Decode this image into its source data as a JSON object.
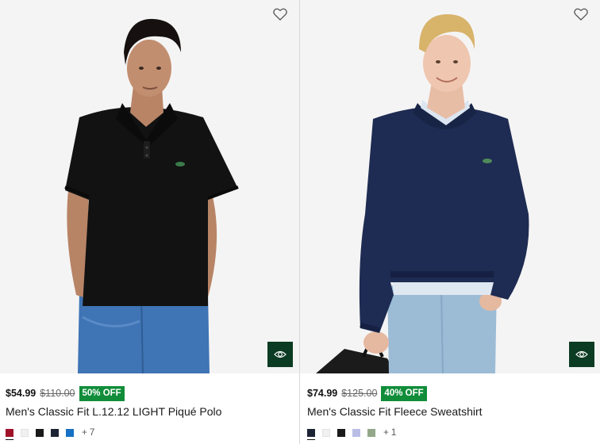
{
  "products": [
    {
      "image_alt": "Men's Classic Fit L.12.12 LIGHT Piqué Polo",
      "wishlist_icon": "heart-icon",
      "quickview_icon": "eye-icon",
      "price": "$54.99",
      "original_price": "$110.00",
      "discount": "50% OFF",
      "title": "Men's Classic Fit L.12.12 LIGHT Piqué Polo",
      "swatches": [
        {
          "color": "#a1122a",
          "light": false,
          "selected": true
        },
        {
          "color": "#f1f1f1",
          "light": true,
          "selected": false
        },
        {
          "color": "#1a1a1a",
          "light": false,
          "selected": false
        },
        {
          "color": "#1c2333",
          "light": false,
          "selected": false
        },
        {
          "color": "#1670c4",
          "light": false,
          "selected": false
        }
      ],
      "more_colors": "+ 7"
    },
    {
      "image_alt": "Men's Classic Fit Fleece Sweatshirt",
      "wishlist_icon": "heart-icon",
      "quickview_icon": "eye-icon",
      "price": "$74.99",
      "original_price": "$125.00",
      "discount": "40% OFF",
      "title": "Men's Classic Fit Fleece Sweatshirt",
      "swatches": [
        {
          "color": "#1c2335",
          "light": false,
          "selected": true
        },
        {
          "color": "#f1f1f1",
          "light": true,
          "selected": false
        },
        {
          "color": "#1a1a1a",
          "light": false,
          "selected": false
        },
        {
          "color": "#b9bde6",
          "light": false,
          "selected": false
        },
        {
          "color": "#93a888",
          "light": false,
          "selected": false
        }
      ],
      "more_colors": "+ 1"
    }
  ],
  "colors": {
    "quickview_bg": "#0b3b22",
    "badge_bg": "#118d3a",
    "image_bg": "#f4f4f4"
  }
}
